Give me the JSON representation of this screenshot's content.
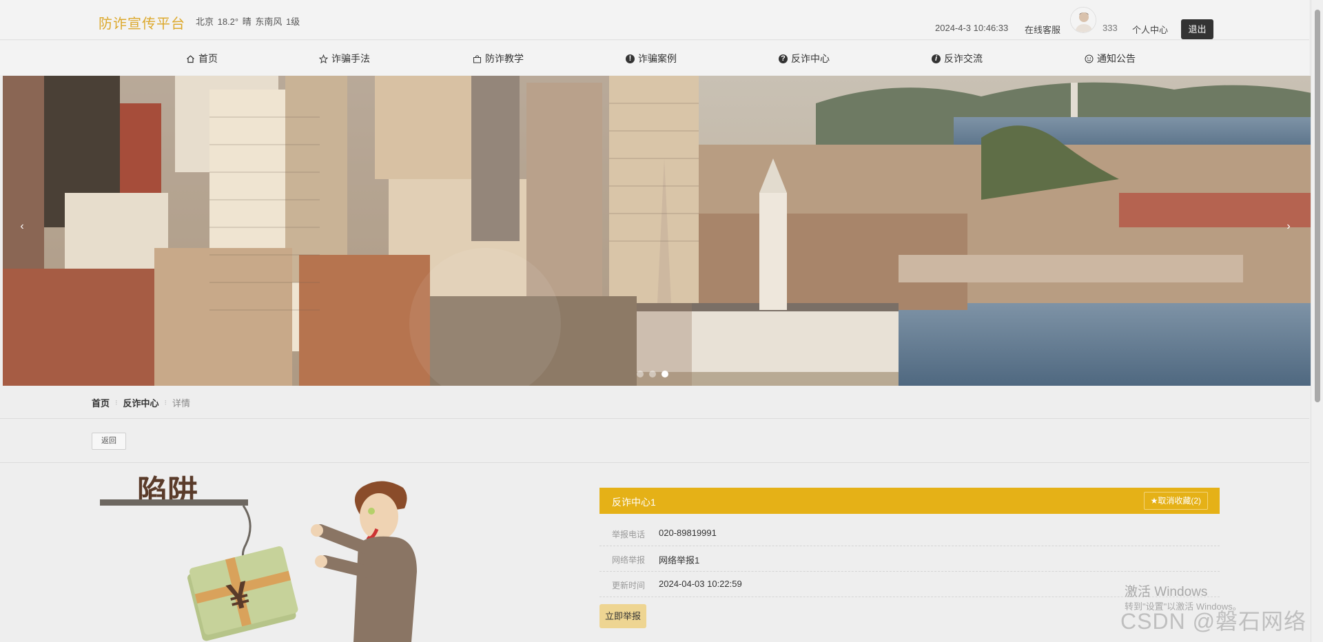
{
  "header": {
    "brand": "防诈宣传平台",
    "weather": "北京 18.2° 晴 东南风 1级",
    "datetime": "2024-4-3 10:46:33",
    "service": "在线客服",
    "username": "333",
    "user_center": "个人中心",
    "logout": "退出"
  },
  "nav": {
    "items": [
      {
        "label": "首页",
        "icon": "home-icon"
      },
      {
        "label": "诈骗手法",
        "icon": "star-icon"
      },
      {
        "label": "防诈教学",
        "icon": "bag-icon"
      },
      {
        "label": "诈骗案例",
        "icon": "exclamation-icon"
      },
      {
        "label": "反诈中心",
        "icon": "question-icon"
      },
      {
        "label": "反诈交流",
        "icon": "info-icon"
      },
      {
        "label": "通知公告",
        "icon": "smile-icon"
      }
    ]
  },
  "banner": {
    "prev_arrow": "‹",
    "next_arrow": "›",
    "slide_count": 3,
    "active_slide": 3
  },
  "breadcrumb": {
    "home": "首页",
    "section": "反诈中心",
    "current": "详情",
    "separator": "⁝"
  },
  "back_button": "返回",
  "detail": {
    "title": "反诈中心1",
    "favorite_button": "★取消收藏(2)",
    "rows": [
      {
        "label": "举报电话",
        "value": "020-89819991"
      },
      {
        "label": "网络举报",
        "value": "网络举报1"
      },
      {
        "label": "更新时间",
        "value": "2024-04-03 10:22:59"
      }
    ],
    "report_button": "立即举报"
  },
  "illustration": {
    "sign_text": "陷阱",
    "money_symbol": "¥"
  },
  "watermarks": {
    "windows_line1": "激活 Windows",
    "windows_line2": "转到\"设置\"以激活 Windows。",
    "csdn": "CSDN @磐石网络"
  },
  "colors": {
    "brand": "#dca82b",
    "detail_header": "#e5b117",
    "report_button": "#eed592",
    "logout_button": "#333333"
  }
}
